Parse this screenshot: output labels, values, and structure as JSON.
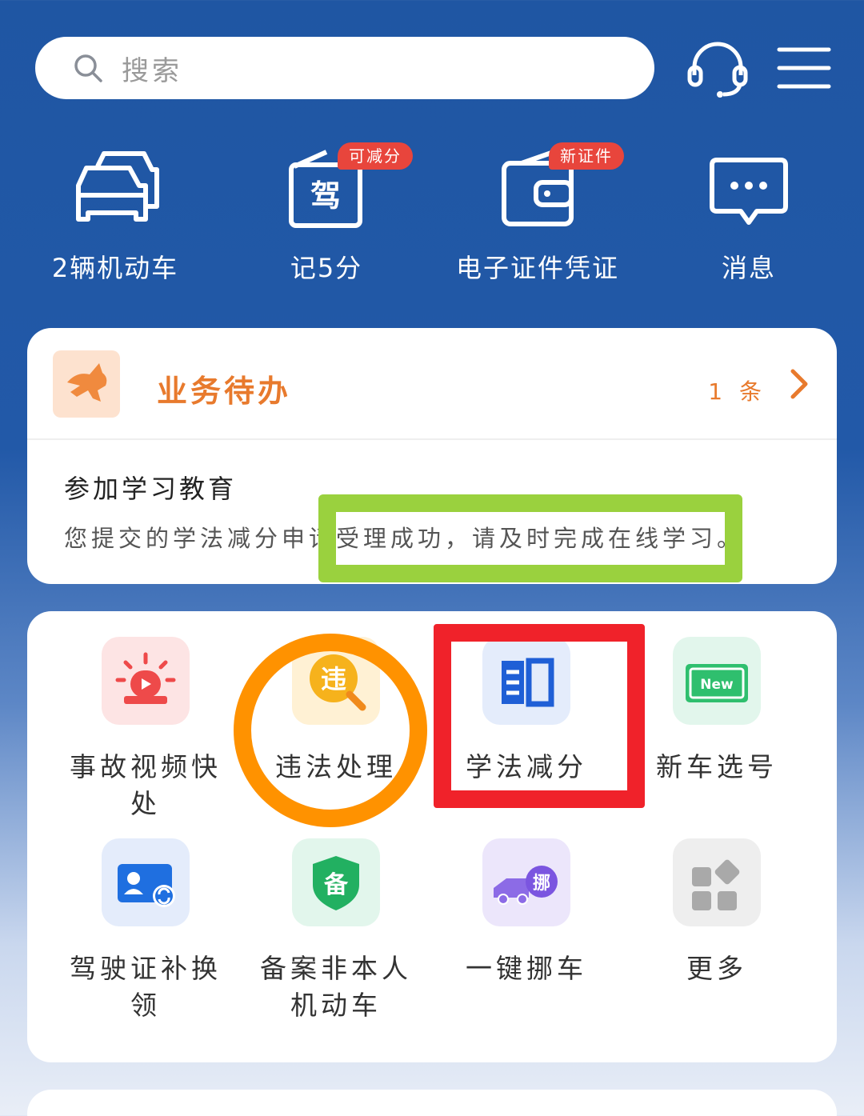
{
  "header": {
    "search_placeholder": "搜索",
    "service_icon": "headset-icon",
    "menu_icon": "hamburger-menu-icon"
  },
  "quick_actions": [
    {
      "label": "2辆机动车",
      "icon": "cars-icon",
      "badge": ""
    },
    {
      "label": "记5分",
      "icon": "license-card-icon",
      "icon_text": "驾",
      "badge": "可减分"
    },
    {
      "label": "电子证件凭证",
      "icon": "wallet-icon",
      "badge": "新证件"
    },
    {
      "label": "消息",
      "icon": "message-bubble-icon",
      "badge": ""
    }
  ],
  "pending": {
    "title": "业务待办",
    "count": "1 条",
    "item_title": "参加学习教育",
    "item_desc": "您提交的学法减分申请受理成功，请及时完成在线学习。"
  },
  "services": [
    {
      "label": "事故视频快处",
      "icon": "siren-video-icon"
    },
    {
      "label": "违法处理",
      "icon": "violation-search-icon",
      "icon_text": "违"
    },
    {
      "label": "学法减分",
      "icon": "open-book-icon"
    },
    {
      "label": "新车选号",
      "icon": "new-plate-icon",
      "icon_text": "New"
    },
    {
      "label": "驾驶证补换领",
      "icon": "id-card-exchange-icon"
    },
    {
      "label": "备案非本人机动车",
      "icon": "shield-record-icon",
      "icon_text": "备"
    },
    {
      "label": "一键挪车",
      "icon": "tow-truck-icon",
      "icon_text": "挪"
    },
    {
      "label": "更多",
      "icon": "grid-more-icon"
    }
  ],
  "colors": {
    "brand_blue": "#2259a8",
    "pending_orange": "#e87a2d",
    "badge_red": "#e8453c",
    "annotation_green": "#9ad13e",
    "annotation_orange": "#ff9200",
    "annotation_red": "#f0222a"
  }
}
